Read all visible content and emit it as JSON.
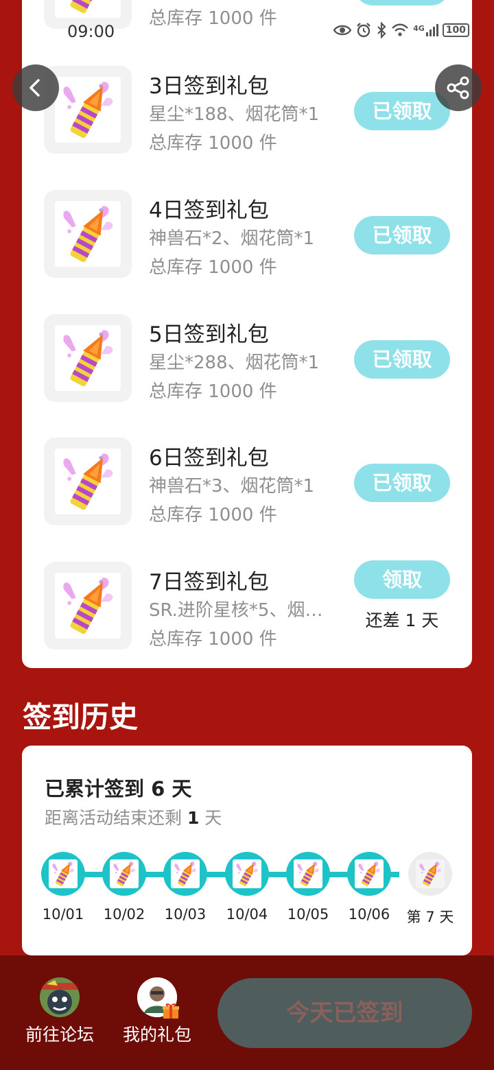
{
  "status_bar": {
    "time": "09:00",
    "network": "4G",
    "battery": "100"
  },
  "top_partial_row": {
    "stock": "总库存 1000 件"
  },
  "gifts": [
    {
      "title": "3日签到礼包",
      "desc": "星尘*188、烟花筒*1",
      "stock": "总库存 1000 件",
      "button": "已领取",
      "hint": ""
    },
    {
      "title": "4日签到礼包",
      "desc": "神兽石*2、烟花筒*1",
      "stock": "总库存 1000 件",
      "button": "已领取",
      "hint": ""
    },
    {
      "title": "5日签到礼包",
      "desc": "星尘*288、烟花筒*1",
      "stock": "总库存 1000 件",
      "button": "已领取",
      "hint": ""
    },
    {
      "title": "6日签到礼包",
      "desc": "神兽石*3、烟花筒*1",
      "stock": "总库存 1000 件",
      "button": "已领取",
      "hint": ""
    },
    {
      "title": "7日签到礼包",
      "desc": "SR.进阶星核*5、烟…",
      "stock": "总库存 1000 件",
      "button": "领取",
      "hint": "还差 1 天"
    }
  ],
  "history": {
    "heading": "签到历史",
    "total_prefix": "已累计签到 ",
    "total_days": "6",
    "total_suffix": " 天",
    "remain_prefix": "距离活动结束还剩 ",
    "remain_days": "1",
    "remain_suffix": " 天",
    "days": [
      "10/01",
      "10/02",
      "10/03",
      "10/04",
      "10/05",
      "10/06",
      "第 7 天"
    ]
  },
  "bottom": {
    "forum_label": "前往论坛",
    "gifts_label": "我的礼包",
    "sign_button": "今天已签到"
  },
  "colors": {
    "background": "#a8150f",
    "accent": "#1ec3c8",
    "button_done": "#8ee1e8",
    "bottom_bar": "#6e0d08"
  }
}
